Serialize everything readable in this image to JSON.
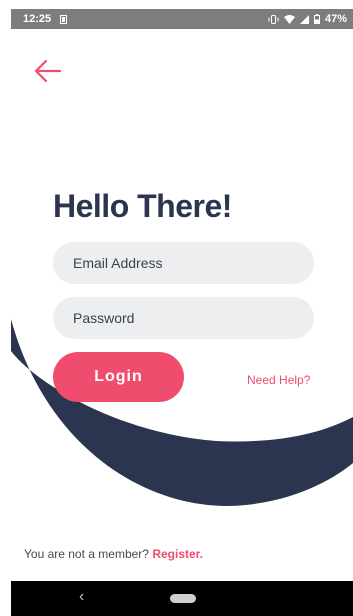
{
  "status_bar": {
    "time": "12:25",
    "battery": "47%",
    "icons": [
      "sim-icon",
      "vibrate-icon",
      "wifi-icon",
      "signal-icon",
      "battery-icon"
    ]
  },
  "header": {
    "back_icon": "arrow-left-icon"
  },
  "main": {
    "title": "Hello There!",
    "email_placeholder": "Email Address",
    "email_value": "",
    "password_placeholder": "Password",
    "password_value": "",
    "login_label": "Login",
    "help_link": "Need Help?"
  },
  "footer": {
    "prompt": "You are not a member?",
    "register_link": "Register."
  },
  "nav_bar": {
    "back_glyph": "‹",
    "icons": [
      "nav-back-icon",
      "nav-home-pill"
    ]
  },
  "colors": {
    "accent": "#ef4c6e",
    "navy": "#2b3550",
    "field_bg": "#eceef0",
    "status_bar": "#7d7d7d"
  }
}
